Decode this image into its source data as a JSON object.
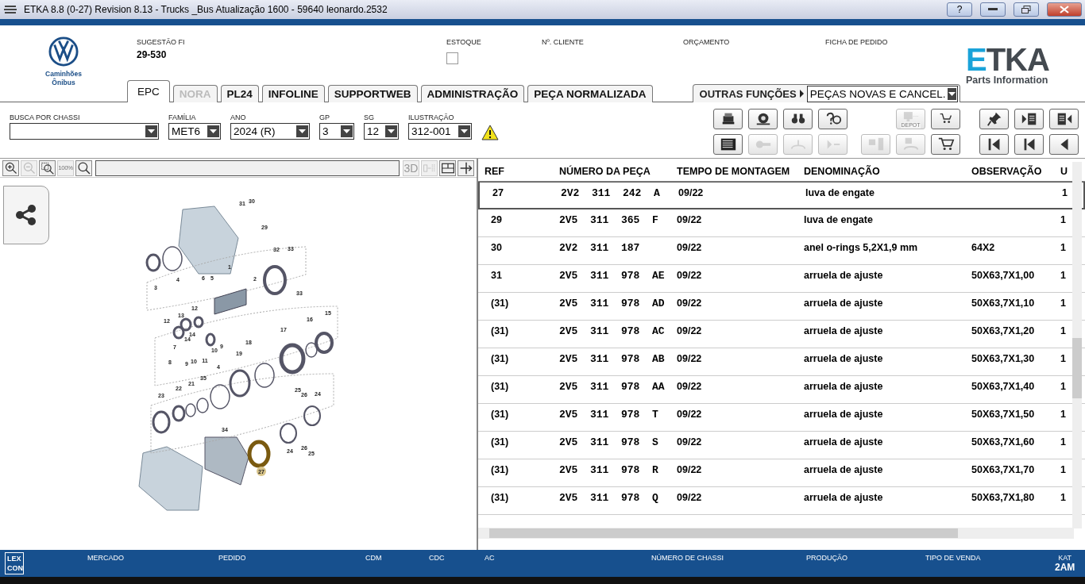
{
  "window": {
    "title": "ETKA 8.8 (0-27) Revision 8.13 - Trucks _Bus Atualização 1600 - 59640 leonardo.2532",
    "controls": [
      "?"
    ]
  },
  "brand": {
    "line1": "Caminhões",
    "line2": "Ônibus",
    "logo_main": "ETKA",
    "logo_sub": "Parts Information"
  },
  "header_fields": [
    {
      "label": "SUGESTÃO FI",
      "value": "29-530"
    },
    {
      "label": "ESTOQUE",
      "kind": "checkbox",
      "checked": false
    },
    {
      "label": "Nº. CLIENTE"
    },
    {
      "label": "ORÇAMENTO"
    },
    {
      "label": "FICHA DE PEDIDO"
    }
  ],
  "tabs": [
    {
      "label": "EPC",
      "selected": true,
      "disabled": false
    },
    {
      "label": "NORA",
      "selected": false,
      "disabled": true
    },
    {
      "label": "PL24",
      "selected": false,
      "disabled": false
    },
    {
      "label": "INFOLINE",
      "selected": false,
      "disabled": false
    },
    {
      "label": "SUPPORTWEB",
      "selected": false,
      "disabled": false
    },
    {
      "label": "ADMINISTRAÇÃO",
      "selected": false,
      "disabled": false
    },
    {
      "label": "PEÇA NORMALIZADA",
      "selected": false,
      "disabled": false
    }
  ],
  "other_functions": {
    "label": "OUTRAS FUNÇÕES",
    "value": "PEÇAS NOVAS E CANCEL."
  },
  "filters": [
    {
      "label": "BUSCA POR CHASSI"
    },
    {
      "label": "FAMÍLIA",
      "value": "MET6"
    },
    {
      "label": "ANO",
      "value": "2024 (R)"
    },
    {
      "label": "GP",
      "value": "3"
    },
    {
      "label": "SG",
      "value": "12"
    },
    {
      "label": "ILUSTRAÇÃO",
      "value": "312-001"
    }
  ],
  "toolbar": [
    {
      "disabled": false
    },
    {
      "disabled": false
    },
    {
      "disabled": false
    },
    {
      "disabled": false
    },
    {
      "disabled": true,
      "label": "DEPOT"
    },
    {
      "disabled": false
    },
    {
      "disabled": false
    },
    {
      "disabled": false
    },
    {
      "disabled": false
    },
    {
      "disabled": false
    },
    {
      "disabled": true
    },
    {
      "disabled": true
    },
    {
      "disabled": true
    },
    {
      "disabled": true
    },
    {
      "disabled": true
    },
    {
      "disabled": false
    },
    {
      "disabled": false
    },
    {
      "disabled": false
    },
    {
      "disabled": false
    }
  ],
  "viewer_toolbar": [
    {
      "disabled": false
    },
    {
      "disabled": true
    },
    {
      "disabled": false
    },
    {
      "disabled": true,
      "label": "100%"
    },
    {
      "disabled": false
    },
    {
      "disabled": true,
      "label": "3D"
    },
    {
      "disabled": true
    },
    {
      "disabled": false
    },
    {
      "disabled": false
    }
  ],
  "callouts": [
    {
      "label": "31",
      "selected": false
    },
    {
      "label": "30",
      "selected": false
    },
    {
      "label": "29",
      "selected": false
    },
    {
      "label": "32",
      "selected": false
    },
    {
      "label": "33",
      "selected": false
    },
    {
      "label": "33",
      "selected": false
    },
    {
      "label": "1",
      "selected": false
    },
    {
      "label": "6",
      "selected": false
    },
    {
      "label": "5",
      "selected": false
    },
    {
      "label": "2",
      "selected": false
    },
    {
      "label": "3",
      "selected": false
    },
    {
      "label": "4",
      "selected": false
    },
    {
      "label": "12",
      "selected": false
    },
    {
      "label": "13",
      "selected": false
    },
    {
      "label": "12",
      "selected": false
    },
    {
      "label": "14",
      "selected": false
    },
    {
      "label": "14",
      "selected": false
    },
    {
      "label": "7",
      "selected": false
    },
    {
      "label": "8",
      "selected": false
    },
    {
      "label": "9",
      "selected": false
    },
    {
      "label": "10",
      "selected": false
    },
    {
      "label": "11",
      "selected": false
    },
    {
      "label": "10",
      "selected": false
    },
    {
      "label": "9",
      "selected": false
    },
    {
      "label": "18",
      "selected": false
    },
    {
      "label": "19",
      "selected": false
    },
    {
      "label": "17",
      "selected": false
    },
    {
      "label": "16",
      "selected": false
    },
    {
      "label": "15",
      "selected": false
    },
    {
      "label": "4",
      "selected": false
    },
    {
      "label": "35",
      "selected": false
    },
    {
      "label": "21",
      "selected": false
    },
    {
      "label": "22",
      "selected": false
    },
    {
      "label": "23",
      "selected": false
    },
    {
      "label": "25",
      "selected": false
    },
    {
      "label": "26",
      "selected": false
    },
    {
      "label": "24",
      "selected": false
    },
    {
      "label": "34",
      "selected": false
    },
    {
      "label": "24",
      "selected": false
    },
    {
      "label": "26",
      "selected": false
    },
    {
      "label": "25",
      "selected": false
    },
    {
      "label": "27",
      "selected": true
    }
  ],
  "table": {
    "columns": [
      "REF",
      "NÚMERO DA PEÇA",
      "TEMPO DE MONTAGEM",
      "DENOMINAÇÃO",
      "OBSERVAÇÃO",
      "U"
    ],
    "rows": [
      {
        "ref": "27",
        "part": "2V2  311  242  A",
        "time": "09/22",
        "name": "luva de engate",
        "col6": "1",
        "selected": true
      },
      {
        "ref": "29",
        "part": "2V5  311  365  F",
        "time": "09/22",
        "name": "luva de engate",
        "col6": "1",
        "selected": false
      },
      {
        "ref": "30",
        "part": "2V2  311  187",
        "time": "09/22",
        "name": "anel o-rings 5,2X1,9 mm",
        "note": "64X2",
        "col6": "1",
        "selected": false
      },
      {
        "ref": "31",
        "part": "2V5  311  978  AE",
        "time": "09/22",
        "name": "arruela de ajuste",
        "note": "50X63,7X1,00",
        "col6": "1",
        "selected": false
      },
      {
        "ref": "(31)",
        "part": "2V5  311  978  AD",
        "time": "09/22",
        "name": "arruela de ajuste",
        "note": "50X63,7X1,10",
        "col6": "1",
        "selected": false
      },
      {
        "ref": "(31)",
        "part": "2V5  311  978  AC",
        "time": "09/22",
        "name": "arruela de ajuste",
        "note": "50X63,7X1,20",
        "col6": "1",
        "selected": false
      },
      {
        "ref": "(31)",
        "part": "2V5  311  978  AB",
        "time": "09/22",
        "name": "arruela de ajuste",
        "note": "50X63,7X1,30",
        "col6": "1",
        "selected": false
      },
      {
        "ref": "(31)",
        "part": "2V5  311  978  AA",
        "time": "09/22",
        "name": "arruela de ajuste",
        "note": "50X63,7X1,40",
        "col6": "1",
        "selected": false
      },
      {
        "ref": "(31)",
        "part": "2V5  311  978  T",
        "time": "09/22",
        "name": "arruela de ajuste",
        "note": "50X63,7X1,50",
        "col6": "1",
        "selected": false
      },
      {
        "ref": "(31)",
        "part": "2V5  311  978  S",
        "time": "09/22",
        "name": "arruela de ajuste",
        "note": "50X63,7X1,60",
        "col6": "1",
        "selected": false
      },
      {
        "ref": "(31)",
        "part": "2V5  311  978  R",
        "time": "09/22",
        "name": "arruela de ajuste",
        "note": "50X63,7X1,70",
        "col6": "1",
        "selected": false
      },
      {
        "ref": "(31)",
        "part": "2V5  311  978  Q",
        "time": "09/22",
        "name": "arruela de ajuste",
        "note": "50X63,7X1,80",
        "col6": "1",
        "selected": false
      }
    ]
  },
  "status_bar": {
    "logo": [
      "LEX",
      "CON"
    ],
    "fields": [
      {
        "label": "MERCADO"
      },
      {
        "label": "PEDIDO"
      },
      {
        "label": "CDM"
      },
      {
        "label": "CDC"
      },
      {
        "label": "AC"
      },
      {
        "label": "NÚMERO DE CHASSI"
      },
      {
        "label": "PRODUÇÃO"
      },
      {
        "label": "TIPO DE VENDA"
      },
      {
        "label": "KAT",
        "value": "2AM"
      }
    ]
  }
}
